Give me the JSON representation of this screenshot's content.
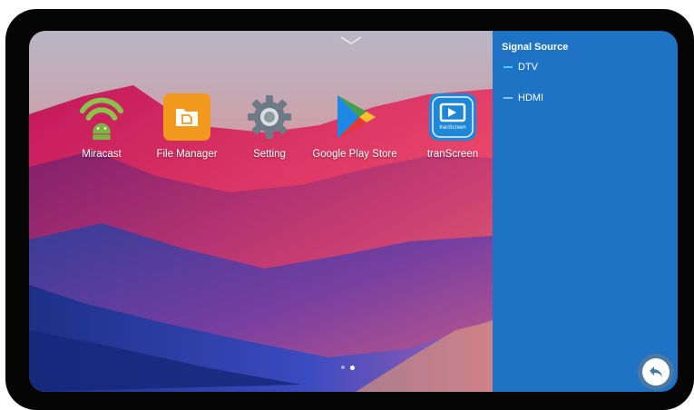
{
  "home": {
    "apps": [
      {
        "label": "Miracast",
        "icon": "miracast-icon"
      },
      {
        "label": "File Manager",
        "icon": "file-manager-icon"
      },
      {
        "label": "Setting",
        "icon": "gear-icon"
      },
      {
        "label": "Google Play Store",
        "icon": "play-store-icon"
      },
      {
        "label": "tranScreen",
        "icon": "transcreen-icon",
        "icon_text": "tranScreen"
      }
    ],
    "page_indicator": {
      "pages": 2,
      "current": 2
    }
  },
  "signal_panel": {
    "title": "Signal Source",
    "sources": [
      {
        "label": "DTV",
        "selected": true
      },
      {
        "label": "HDMI",
        "selected": false
      }
    ]
  },
  "colors": {
    "panel": "#1f73c4",
    "selected_marker": "#3fd0ff",
    "unselected_marker": "#8fbde6",
    "accent_file_manager": "#f19a1e",
    "accent_transcreen": "#1e88d6"
  }
}
